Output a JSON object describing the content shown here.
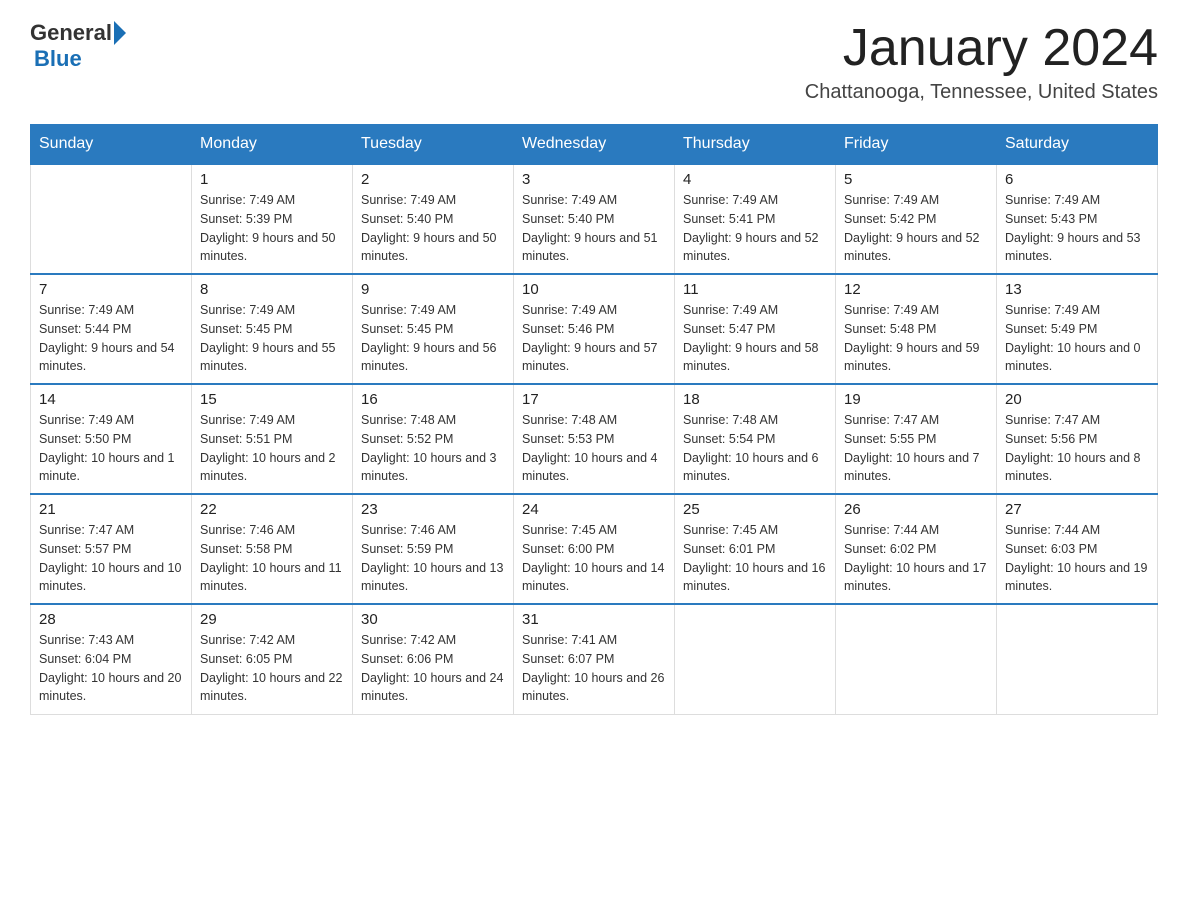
{
  "header": {
    "logo_general": "General",
    "logo_blue": "Blue",
    "month_title": "January 2024",
    "location": "Chattanooga, Tennessee, United States"
  },
  "weekdays": [
    "Sunday",
    "Monday",
    "Tuesday",
    "Wednesday",
    "Thursday",
    "Friday",
    "Saturday"
  ],
  "weeks": [
    [
      {
        "day": "",
        "sunrise": "",
        "sunset": "",
        "daylight": ""
      },
      {
        "day": "1",
        "sunrise": "Sunrise: 7:49 AM",
        "sunset": "Sunset: 5:39 PM",
        "daylight": "Daylight: 9 hours and 50 minutes."
      },
      {
        "day": "2",
        "sunrise": "Sunrise: 7:49 AM",
        "sunset": "Sunset: 5:40 PM",
        "daylight": "Daylight: 9 hours and 50 minutes."
      },
      {
        "day": "3",
        "sunrise": "Sunrise: 7:49 AM",
        "sunset": "Sunset: 5:40 PM",
        "daylight": "Daylight: 9 hours and 51 minutes."
      },
      {
        "day": "4",
        "sunrise": "Sunrise: 7:49 AM",
        "sunset": "Sunset: 5:41 PM",
        "daylight": "Daylight: 9 hours and 52 minutes."
      },
      {
        "day": "5",
        "sunrise": "Sunrise: 7:49 AM",
        "sunset": "Sunset: 5:42 PM",
        "daylight": "Daylight: 9 hours and 52 minutes."
      },
      {
        "day": "6",
        "sunrise": "Sunrise: 7:49 AM",
        "sunset": "Sunset: 5:43 PM",
        "daylight": "Daylight: 9 hours and 53 minutes."
      }
    ],
    [
      {
        "day": "7",
        "sunrise": "Sunrise: 7:49 AM",
        "sunset": "Sunset: 5:44 PM",
        "daylight": "Daylight: 9 hours and 54 minutes."
      },
      {
        "day": "8",
        "sunrise": "Sunrise: 7:49 AM",
        "sunset": "Sunset: 5:45 PM",
        "daylight": "Daylight: 9 hours and 55 minutes."
      },
      {
        "day": "9",
        "sunrise": "Sunrise: 7:49 AM",
        "sunset": "Sunset: 5:45 PM",
        "daylight": "Daylight: 9 hours and 56 minutes."
      },
      {
        "day": "10",
        "sunrise": "Sunrise: 7:49 AM",
        "sunset": "Sunset: 5:46 PM",
        "daylight": "Daylight: 9 hours and 57 minutes."
      },
      {
        "day": "11",
        "sunrise": "Sunrise: 7:49 AM",
        "sunset": "Sunset: 5:47 PM",
        "daylight": "Daylight: 9 hours and 58 minutes."
      },
      {
        "day": "12",
        "sunrise": "Sunrise: 7:49 AM",
        "sunset": "Sunset: 5:48 PM",
        "daylight": "Daylight: 9 hours and 59 minutes."
      },
      {
        "day": "13",
        "sunrise": "Sunrise: 7:49 AM",
        "sunset": "Sunset: 5:49 PM",
        "daylight": "Daylight: 10 hours and 0 minutes."
      }
    ],
    [
      {
        "day": "14",
        "sunrise": "Sunrise: 7:49 AM",
        "sunset": "Sunset: 5:50 PM",
        "daylight": "Daylight: 10 hours and 1 minute."
      },
      {
        "day": "15",
        "sunrise": "Sunrise: 7:49 AM",
        "sunset": "Sunset: 5:51 PM",
        "daylight": "Daylight: 10 hours and 2 minutes."
      },
      {
        "day": "16",
        "sunrise": "Sunrise: 7:48 AM",
        "sunset": "Sunset: 5:52 PM",
        "daylight": "Daylight: 10 hours and 3 minutes."
      },
      {
        "day": "17",
        "sunrise": "Sunrise: 7:48 AM",
        "sunset": "Sunset: 5:53 PM",
        "daylight": "Daylight: 10 hours and 4 minutes."
      },
      {
        "day": "18",
        "sunrise": "Sunrise: 7:48 AM",
        "sunset": "Sunset: 5:54 PM",
        "daylight": "Daylight: 10 hours and 6 minutes."
      },
      {
        "day": "19",
        "sunrise": "Sunrise: 7:47 AM",
        "sunset": "Sunset: 5:55 PM",
        "daylight": "Daylight: 10 hours and 7 minutes."
      },
      {
        "day": "20",
        "sunrise": "Sunrise: 7:47 AM",
        "sunset": "Sunset: 5:56 PM",
        "daylight": "Daylight: 10 hours and 8 minutes."
      }
    ],
    [
      {
        "day": "21",
        "sunrise": "Sunrise: 7:47 AM",
        "sunset": "Sunset: 5:57 PM",
        "daylight": "Daylight: 10 hours and 10 minutes."
      },
      {
        "day": "22",
        "sunrise": "Sunrise: 7:46 AM",
        "sunset": "Sunset: 5:58 PM",
        "daylight": "Daylight: 10 hours and 11 minutes."
      },
      {
        "day": "23",
        "sunrise": "Sunrise: 7:46 AM",
        "sunset": "Sunset: 5:59 PM",
        "daylight": "Daylight: 10 hours and 13 minutes."
      },
      {
        "day": "24",
        "sunrise": "Sunrise: 7:45 AM",
        "sunset": "Sunset: 6:00 PM",
        "daylight": "Daylight: 10 hours and 14 minutes."
      },
      {
        "day": "25",
        "sunrise": "Sunrise: 7:45 AM",
        "sunset": "Sunset: 6:01 PM",
        "daylight": "Daylight: 10 hours and 16 minutes."
      },
      {
        "day": "26",
        "sunrise": "Sunrise: 7:44 AM",
        "sunset": "Sunset: 6:02 PM",
        "daylight": "Daylight: 10 hours and 17 minutes."
      },
      {
        "day": "27",
        "sunrise": "Sunrise: 7:44 AM",
        "sunset": "Sunset: 6:03 PM",
        "daylight": "Daylight: 10 hours and 19 minutes."
      }
    ],
    [
      {
        "day": "28",
        "sunrise": "Sunrise: 7:43 AM",
        "sunset": "Sunset: 6:04 PM",
        "daylight": "Daylight: 10 hours and 20 minutes."
      },
      {
        "day": "29",
        "sunrise": "Sunrise: 7:42 AM",
        "sunset": "Sunset: 6:05 PM",
        "daylight": "Daylight: 10 hours and 22 minutes."
      },
      {
        "day": "30",
        "sunrise": "Sunrise: 7:42 AM",
        "sunset": "Sunset: 6:06 PM",
        "daylight": "Daylight: 10 hours and 24 minutes."
      },
      {
        "day": "31",
        "sunrise": "Sunrise: 7:41 AM",
        "sunset": "Sunset: 6:07 PM",
        "daylight": "Daylight: 10 hours and 26 minutes."
      },
      {
        "day": "",
        "sunrise": "",
        "sunset": "",
        "daylight": ""
      },
      {
        "day": "",
        "sunrise": "",
        "sunset": "",
        "daylight": ""
      },
      {
        "day": "",
        "sunrise": "",
        "sunset": "",
        "daylight": ""
      }
    ]
  ]
}
